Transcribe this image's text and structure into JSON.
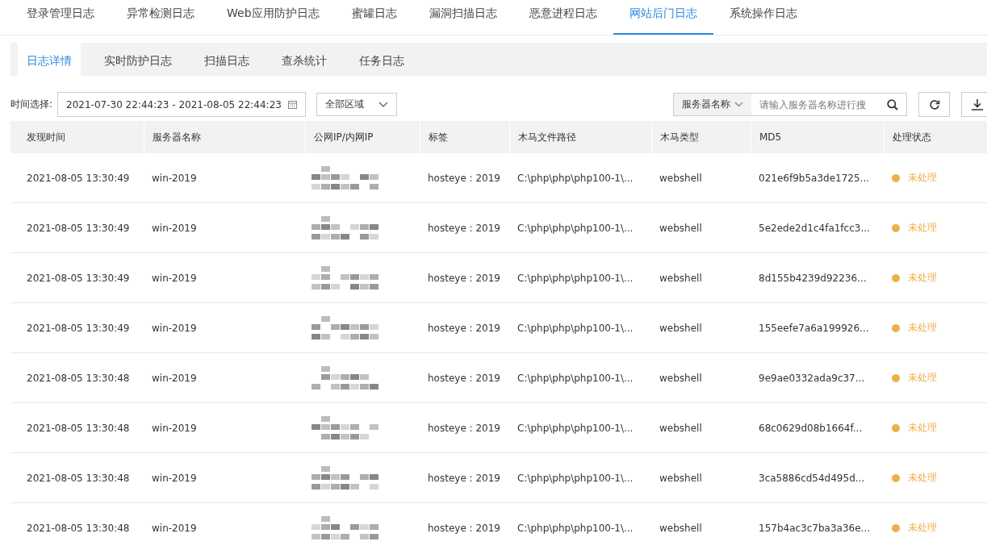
{
  "top_tabs": [
    {
      "label": "登录管理日志",
      "selected": false
    },
    {
      "label": "异常检测日志",
      "selected": false
    },
    {
      "label": "Web应用防护日志",
      "selected": false
    },
    {
      "label": "蜜罐日志",
      "selected": false
    },
    {
      "label": "漏洞扫描日志",
      "selected": false
    },
    {
      "label": "恶意进程日志",
      "selected": false
    },
    {
      "label": "网站后门日志",
      "selected": true
    },
    {
      "label": "系统操作日志",
      "selected": false
    }
  ],
  "sub_tabs": [
    {
      "label": "日志详情",
      "selected": true
    },
    {
      "label": "实时防护日志",
      "selected": false
    },
    {
      "label": "扫描日志",
      "selected": false
    },
    {
      "label": "查杀统计",
      "selected": false
    },
    {
      "label": "任务日志",
      "selected": false
    }
  ],
  "filters": {
    "time_label": "时间选择:",
    "time_range": "2021-07-30 22:44:23 - 2021-08-05 22:44:23",
    "region": "全部区域",
    "search_scope": "服务器名称",
    "search_placeholder": "请输入服务器名称进行搜"
  },
  "table": {
    "columns": [
      "发现时间",
      "服务器名称",
      "公网IP/内网IP",
      "标签",
      "木马文件路径",
      "木马类型",
      "MD5",
      "处理状态"
    ],
    "rows": [
      {
        "time": "2021-08-05 13:30:49",
        "server": "win-2019",
        "tag": "hosteye : 2019",
        "path": "C:\\php\\php\\php100-1\\...",
        "type": "webshell",
        "md5": "021e6f9b5a3de1725...",
        "status": "未处理",
        "color": "#f0ad4e"
      },
      {
        "time": "2021-08-05 13:30:49",
        "server": "win-2019",
        "tag": "hosteye : 2019",
        "path": "C:\\php\\php\\php100-1\\...",
        "type": "webshell",
        "md5": "5e2ede2d1c4fa1fcc3...",
        "status": "未处理",
        "color": "#f0ad4e"
      },
      {
        "time": "2021-08-05 13:30:49",
        "server": "win-2019",
        "tag": "hosteye : 2019",
        "path": "C:\\php\\php\\php100-1\\...",
        "type": "webshell",
        "md5": "8d155b4239d92236...",
        "status": "未处理",
        "color": "#f0ad4e"
      },
      {
        "time": "2021-08-05 13:30:49",
        "server": "win-2019",
        "tag": "hosteye : 2019",
        "path": "C:\\php\\php\\php100-1\\...",
        "type": "webshell",
        "md5": "155eefe7a6a199926...",
        "status": "未处理",
        "color": "#f0ad4e"
      },
      {
        "time": "2021-08-05 13:30:48",
        "server": "win-2019",
        "tag": "hosteye : 2019",
        "path": "C:\\php\\php\\php100-1\\...",
        "type": "webshell",
        "md5": "9e9ae0332ada9c37...",
        "status": "未处理",
        "color": "#f0ad4e"
      },
      {
        "time": "2021-08-05 13:30:48",
        "server": "win-2019",
        "tag": "hosteye : 2019",
        "path": "C:\\php\\php\\php100-1\\...",
        "type": "webshell",
        "md5": "68c0629d08b1664f...",
        "status": "未处理",
        "color": "#f0ad4e"
      },
      {
        "time": "2021-08-05 13:30:48",
        "server": "win-2019",
        "tag": "hosteye : 2019",
        "path": "C:\\php\\php\\php100-1\\...",
        "type": "webshell",
        "md5": "3ca5886cd54d495d...",
        "status": "未处理",
        "color": "#f0ad4e"
      },
      {
        "time": "2021-08-05 13:30:48",
        "server": "win-2019",
        "tag": "hosteye : 2019",
        "path": "C:\\php\\php\\php100-1\\...",
        "type": "webshell",
        "md5": "157b4ac3c7ba3a36e...",
        "status": "未处理",
        "color": "#f0ad4e"
      }
    ]
  }
}
